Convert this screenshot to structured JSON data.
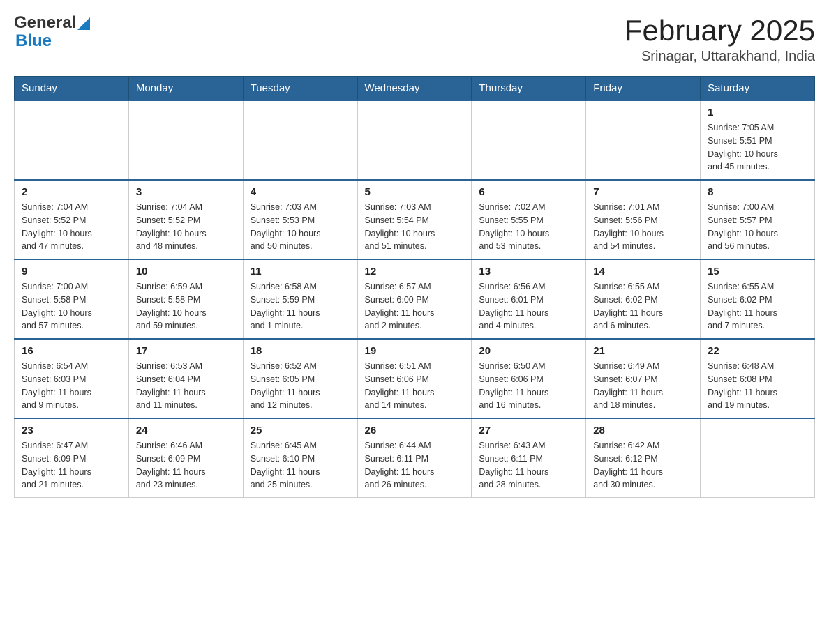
{
  "header": {
    "logo_general": "General",
    "logo_blue": "Blue",
    "month_year": "February 2025",
    "location": "Srinagar, Uttarakhand, India"
  },
  "weekdays": [
    "Sunday",
    "Monday",
    "Tuesday",
    "Wednesday",
    "Thursday",
    "Friday",
    "Saturday"
  ],
  "weeks": [
    [
      {
        "day": "",
        "info": ""
      },
      {
        "day": "",
        "info": ""
      },
      {
        "day": "",
        "info": ""
      },
      {
        "day": "",
        "info": ""
      },
      {
        "day": "",
        "info": ""
      },
      {
        "day": "",
        "info": ""
      },
      {
        "day": "1",
        "info": "Sunrise: 7:05 AM\nSunset: 5:51 PM\nDaylight: 10 hours\nand 45 minutes."
      }
    ],
    [
      {
        "day": "2",
        "info": "Sunrise: 7:04 AM\nSunset: 5:52 PM\nDaylight: 10 hours\nand 47 minutes."
      },
      {
        "day": "3",
        "info": "Sunrise: 7:04 AM\nSunset: 5:52 PM\nDaylight: 10 hours\nand 48 minutes."
      },
      {
        "day": "4",
        "info": "Sunrise: 7:03 AM\nSunset: 5:53 PM\nDaylight: 10 hours\nand 50 minutes."
      },
      {
        "day": "5",
        "info": "Sunrise: 7:03 AM\nSunset: 5:54 PM\nDaylight: 10 hours\nand 51 minutes."
      },
      {
        "day": "6",
        "info": "Sunrise: 7:02 AM\nSunset: 5:55 PM\nDaylight: 10 hours\nand 53 minutes."
      },
      {
        "day": "7",
        "info": "Sunrise: 7:01 AM\nSunset: 5:56 PM\nDaylight: 10 hours\nand 54 minutes."
      },
      {
        "day": "8",
        "info": "Sunrise: 7:00 AM\nSunset: 5:57 PM\nDaylight: 10 hours\nand 56 minutes."
      }
    ],
    [
      {
        "day": "9",
        "info": "Sunrise: 7:00 AM\nSunset: 5:58 PM\nDaylight: 10 hours\nand 57 minutes."
      },
      {
        "day": "10",
        "info": "Sunrise: 6:59 AM\nSunset: 5:58 PM\nDaylight: 10 hours\nand 59 minutes."
      },
      {
        "day": "11",
        "info": "Sunrise: 6:58 AM\nSunset: 5:59 PM\nDaylight: 11 hours\nand 1 minute."
      },
      {
        "day": "12",
        "info": "Sunrise: 6:57 AM\nSunset: 6:00 PM\nDaylight: 11 hours\nand 2 minutes."
      },
      {
        "day": "13",
        "info": "Sunrise: 6:56 AM\nSunset: 6:01 PM\nDaylight: 11 hours\nand 4 minutes."
      },
      {
        "day": "14",
        "info": "Sunrise: 6:55 AM\nSunset: 6:02 PM\nDaylight: 11 hours\nand 6 minutes."
      },
      {
        "day": "15",
        "info": "Sunrise: 6:55 AM\nSunset: 6:02 PM\nDaylight: 11 hours\nand 7 minutes."
      }
    ],
    [
      {
        "day": "16",
        "info": "Sunrise: 6:54 AM\nSunset: 6:03 PM\nDaylight: 11 hours\nand 9 minutes."
      },
      {
        "day": "17",
        "info": "Sunrise: 6:53 AM\nSunset: 6:04 PM\nDaylight: 11 hours\nand 11 minutes."
      },
      {
        "day": "18",
        "info": "Sunrise: 6:52 AM\nSunset: 6:05 PM\nDaylight: 11 hours\nand 12 minutes."
      },
      {
        "day": "19",
        "info": "Sunrise: 6:51 AM\nSunset: 6:06 PM\nDaylight: 11 hours\nand 14 minutes."
      },
      {
        "day": "20",
        "info": "Sunrise: 6:50 AM\nSunset: 6:06 PM\nDaylight: 11 hours\nand 16 minutes."
      },
      {
        "day": "21",
        "info": "Sunrise: 6:49 AM\nSunset: 6:07 PM\nDaylight: 11 hours\nand 18 minutes."
      },
      {
        "day": "22",
        "info": "Sunrise: 6:48 AM\nSunset: 6:08 PM\nDaylight: 11 hours\nand 19 minutes."
      }
    ],
    [
      {
        "day": "23",
        "info": "Sunrise: 6:47 AM\nSunset: 6:09 PM\nDaylight: 11 hours\nand 21 minutes."
      },
      {
        "day": "24",
        "info": "Sunrise: 6:46 AM\nSunset: 6:09 PM\nDaylight: 11 hours\nand 23 minutes."
      },
      {
        "day": "25",
        "info": "Sunrise: 6:45 AM\nSunset: 6:10 PM\nDaylight: 11 hours\nand 25 minutes."
      },
      {
        "day": "26",
        "info": "Sunrise: 6:44 AM\nSunset: 6:11 PM\nDaylight: 11 hours\nand 26 minutes."
      },
      {
        "day": "27",
        "info": "Sunrise: 6:43 AM\nSunset: 6:11 PM\nDaylight: 11 hours\nand 28 minutes."
      },
      {
        "day": "28",
        "info": "Sunrise: 6:42 AM\nSunset: 6:12 PM\nDaylight: 11 hours\nand 30 minutes."
      },
      {
        "day": "",
        "info": ""
      }
    ]
  ]
}
